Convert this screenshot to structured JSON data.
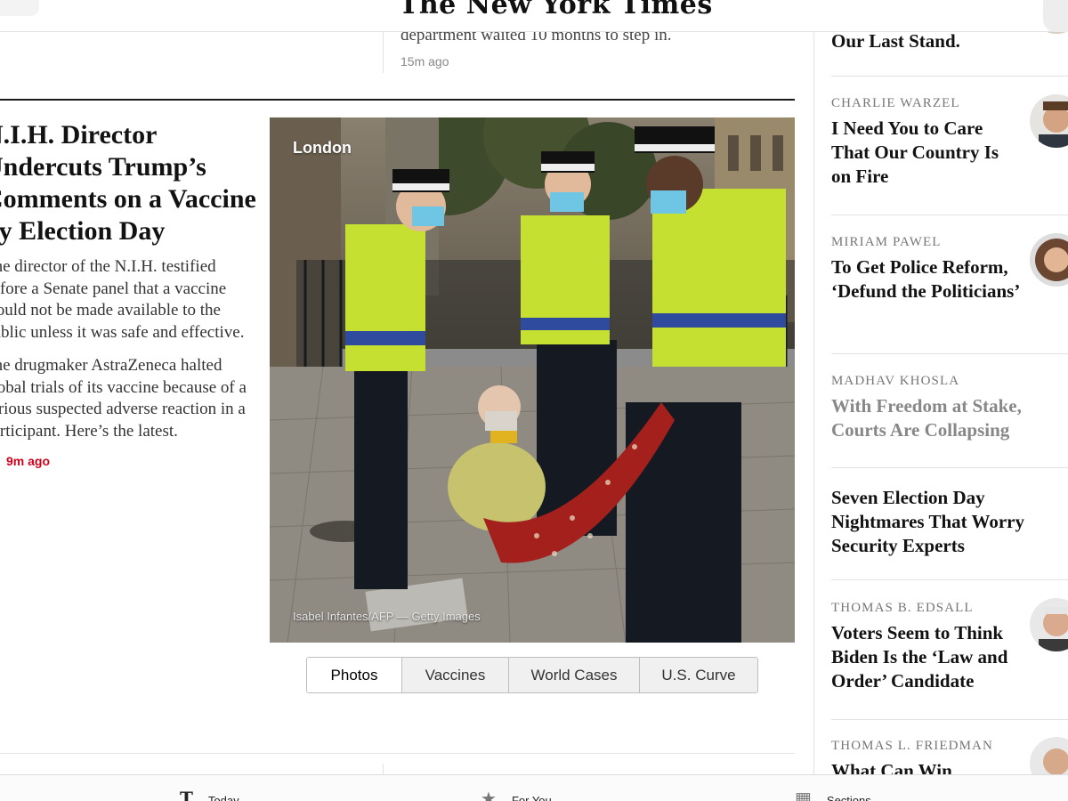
{
  "masthead": {
    "logo": "The New York Times"
  },
  "top_story": {
    "summary": "department waited 10 months to step in.",
    "time": "15m ago"
  },
  "lead_story": {
    "headline_lines": [
      "N.I.H. Director",
      "Undercuts Trump’s",
      "Comments on a Vaccine",
      "by Election Day"
    ],
    "bullets": [
      "The director of the N.I.H. testified before a Senate panel that a vaccine would not be made available to the public unless it was safe and effective.",
      "The drugmaker AstraZeneca halted global trials of its vaccine because of a serious suspected adverse reaction in a participant. Here’s the latest."
    ],
    "time": "9m ago",
    "colors": {
      "live": "#d0021b"
    }
  },
  "photo": {
    "location": "London",
    "credit": "Isabel Infantes/AFP — Getty Images"
  },
  "photo_tabs": [
    {
      "label": "Photos",
      "selected": true
    },
    {
      "label": "Vaccines",
      "selected": false
    },
    {
      "label": "World Cases",
      "selected": false
    },
    {
      "label": "U.S. Curve",
      "selected": false
    }
  ],
  "opinion": [
    {
      "author": "",
      "headline": "Our Last Stand.",
      "muted": false
    },
    {
      "author": "CHARLIE WARZEL",
      "headline": "I Need You to Care That Our Country Is on Fire",
      "muted": false
    },
    {
      "author": "MIRIAM PAWEL",
      "headline": "To Get Police Reform, ‘Defund the Politicians’",
      "muted": false
    },
    {
      "author": "MADHAV KHOSLA",
      "headline": "With Freedom at Stake, Courts Are Collapsing",
      "muted": true
    },
    {
      "author": "",
      "headline": "Seven Election Day Nightmares That Worry Security Experts",
      "muted": false
    },
    {
      "author": "THOMAS B. EDSALL",
      "headline": "Voters Seem to Think Biden Is the ‘Law and Order’ Candidate",
      "muted": false
    },
    {
      "author": "THOMAS L. FRIEDMAN",
      "headline": "What Can Win",
      "muted": false
    }
  ],
  "bottom_tabbar": {
    "items": [
      {
        "icon": "nyt-t-icon",
        "label": "Today"
      },
      {
        "icon": "star-icon",
        "label": "For You"
      },
      {
        "icon": "sections-icon",
        "label": "Sections"
      }
    ]
  }
}
